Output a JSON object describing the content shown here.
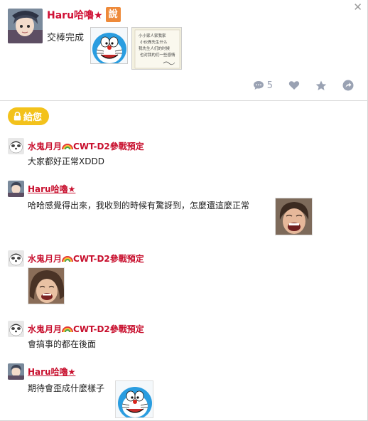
{
  "post": {
    "author": "Haru哈嚕★",
    "badge": "說",
    "text": "交棒完成",
    "comment_count": "5",
    "lock_button": "給您"
  },
  "note_lines": [
    "小小家人家我家",
    "小伙做先生什么",
    "我先生人们的时候",
    "也对我的们一些感情"
  ],
  "comments": [
    {
      "author_prefix": "水鬼月月",
      "author_suffix": "CWT-D2參戰預定",
      "text": "大家都好正常XDDD"
    },
    {
      "author": "Haru哈嚕★",
      "text": "哈哈感覺得出來，我收到的時候有驚訝到，怎麼還這麼正常"
    },
    {
      "author_prefix": "水鬼月月",
      "author_suffix": "CWT-D2參戰預定",
      "text": ""
    },
    {
      "author_prefix": "水鬼月月",
      "author_suffix": "CWT-D2參戰預定",
      "text": "會搞事的都在後面"
    },
    {
      "author": "Haru哈嚕★",
      "text": "期待會歪成什麼樣子"
    }
  ],
  "colors": {
    "name": "#c8102e",
    "badge": "#ee8a3a",
    "lock": "#f3c21b",
    "icons": "#9aa2b3"
  }
}
